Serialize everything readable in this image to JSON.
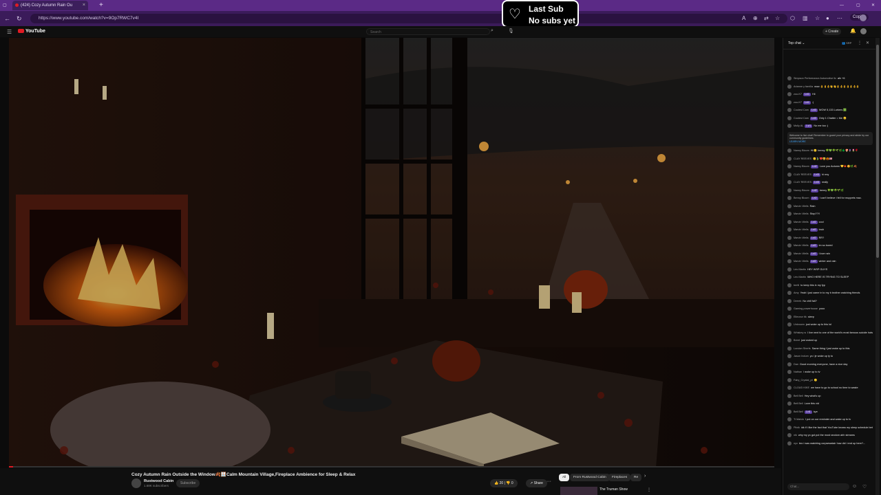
{
  "browser": {
    "tab_title": "(424) Cozy Autumn Rain Ou",
    "tab_close": "×",
    "new_tab": "+",
    "url": "https://www.youtube.com/watch?v=9Op7RWC7v4I",
    "copilot": "Copilot"
  },
  "overlay": {
    "heart_icon": "♡",
    "line1": "Last Sub",
    "line2": "No subs yet"
  },
  "youtube": {
    "logo": "YouTube",
    "search_placeholder": "Search",
    "create": "+ Create"
  },
  "video": {
    "title": "Cozy Autumn Rain Outside the Window🍂🪟Calm Mountain Village,Fireplace Ambience for Sleep & Relax",
    "progress_fraction": 0.005,
    "channel_name": "Rustwood Cabin",
    "channel_subs": "1.68K subscribers",
    "subscribe": "Subscribe",
    "likes": "👍 20",
    "dislikes": "👎 0",
    "share": "↗ Share",
    "more": "···"
  },
  "recs": {
    "chips": [
      "All",
      "From Rustwood Cabin",
      "Fireplaces",
      "Re"
    ],
    "chip_next": "›",
    "first_title": "The Truman Show",
    "more": "⋮"
  },
  "chat": {
    "header": "Top chat ⌄",
    "pinned": "👥 SRP",
    "welcome": "Welcome to live chat! Remember to guard your privacy and abide by our community guidelines.",
    "learn_more": "LEARN MORE",
    "input_placeholder": "Chat...",
    "messages": [
      {
        "author": "Simpson Performance Automotive llc",
        "badge": "",
        "text": "afx +6"
      },
      {
        "author": "Arianne y familia",
        "badge": "",
        "text": "wow 👌👌👌👋👋👌👌👌👌👌👌👌"
      },
      {
        "author": "zoo-K7",
        "badge": "Lvl1",
        "text": "Hii"
      },
      {
        "author": "zoo-K7",
        "badge": "Lvl1",
        "text": ":)"
      },
      {
        "author": "Coolest Cam",
        "badge": "Lvl3",
        "text": "WOW 5,133 Lurkers 🟩"
      },
      {
        "author": "Coolest Cam",
        "badge": "Lvl3",
        "text": "Only 1 Chatter = Me 😊"
      },
      {
        "author": "Molly AL",
        "badge": "Lvl1",
        "text": "No me too :)"
      },
      {
        "author": "Nanny Bloom",
        "badge": "",
        "text": "Hi 🙂 benny 🍀💚🌳🌱🌿🌲🍄🪻🌷🌹"
      },
      {
        "author": "CLAY REEVES",
        "badge": "",
        "text": "🙂🍃❤️😅🎃🇺🇸"
      },
      {
        "author": "Nanny Bloom",
        "badge": "Lvl2",
        "text": "Love you Autumn 💛🍁🌼🌿🍂"
      },
      {
        "author": "CLAY REEVES",
        "badge": "Lvl3",
        "text": "hi rmy"
      },
      {
        "author": "CLAY REEVES",
        "badge": "Lvl3",
        "text": "really"
      },
      {
        "author": "Nanny Bloom",
        "badge": "Lvl2",
        "text": "benny 🍀💚🌳🌱🌿"
      },
      {
        "author": "Benny Bloom",
        "badge": "Lvl2",
        "text": "I can't believe i fell for muppets mac."
      },
      {
        "author": "Marvin Wells",
        "badge": "",
        "text": "Rain"
      },
      {
        "author": "Marvin Wells",
        "badge": "",
        "text": "Stop??!!"
      },
      {
        "author": "Marvin Wells",
        "badge": "Lvl2",
        "text": "cool"
      },
      {
        "author": "Marvin Wells",
        "badge": "Lvl2",
        "text": "bruh"
      },
      {
        "author": "Marvin Wells",
        "badge": "Lvl2",
        "text": "RR?"
      },
      {
        "author": "Marvin Wells",
        "badge": "Lvl2",
        "text": "im so bored"
      },
      {
        "author": "Marvin Wells",
        "badge": "Lvl2",
        "text": "i love rain"
      },
      {
        "author": "Marvin Wells",
        "badge": "Lvl2",
        "text": "winter and rain"
      },
      {
        "author": "Léo Martin",
        "badge": "",
        "text": "HEY WSP GUYS"
      },
      {
        "author": "Léo Martin",
        "badge": "",
        "text": "WHO HERE IS TRYING TO SLEEP"
      },
      {
        "author": "bertli",
        "badge": "",
        "text": "to keep this in my fyp"
      },
      {
        "author": "Amy",
        "badge": "",
        "text": "Yeah i just came in to my b brother watching friends"
      },
      {
        "author": "Derrek",
        "badge": "",
        "text": "No chill fall?"
      },
      {
        "author": "Gaming powerhouse",
        "badge": "",
        "text": "yooo"
      },
      {
        "author": "Elleonor tik",
        "badge": "",
        "text": "sleep"
      },
      {
        "author": "Unknown",
        "badge": "",
        "text": "just woke up to this lol"
      },
      {
        "author": "Whiskey w",
        "badge": "",
        "text": "I live next to one of the world's most famous suicide hotspots. If i woke up to this again I'm adding to the stats."
      },
      {
        "author": "Breet",
        "badge": "",
        "text": "just woked up"
      },
      {
        "author": "London Sherfs",
        "badge": "",
        "text": "Same thing I just woke up to this"
      },
      {
        "author": "Jason Indum",
        "badge": "",
        "text": "yo i je woke up ty to"
      },
      {
        "author": "Dan",
        "badge": "",
        "text": "Good morning everyone, have a nice day"
      },
      {
        "author": "Nathan",
        "badge": "",
        "text": "i woke up to tv"
      },
      {
        "author": "Fairy_Crystal_pt",
        "badge": "",
        "text": "🙂"
      },
      {
        "author": "CLOUD KIKE",
        "badge": "",
        "text": "we have to go to school no time to waste"
      },
      {
        "author": "Bell Bell",
        "badge": "",
        "text": "Hey what's up"
      },
      {
        "author": "Bell Bell",
        "badge": "",
        "text": "Love this vid"
      },
      {
        "author": "Bell Bell",
        "badge": "Lvl1",
        "text": "bye"
      },
      {
        "author": "Ti Malvin",
        "badge": "",
        "text": "I put on our reminder and wake up to tv"
      },
      {
        "author": "Plixik",
        "badge": "",
        "text": "idk if i like the fact that YouTube knows my sleep schedule better than i do"
      },
      {
        "author": "nik",
        "badge": "",
        "text": "why my yo got put the most random ahh streams"
      },
      {
        "author": "nyx",
        "badge": "",
        "text": "bro i was watching corpsewstair how did i end up here?..."
      }
    ]
  }
}
